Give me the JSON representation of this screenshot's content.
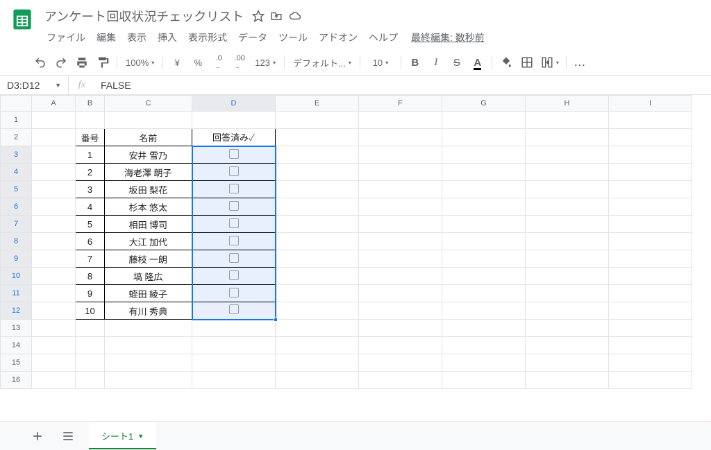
{
  "doc": {
    "title": "アンケート回収状況チェックリスト"
  },
  "menus": [
    "ファイル",
    "編集",
    "表示",
    "挿入",
    "表示形式",
    "データ",
    "ツール",
    "アドオン",
    "ヘルプ"
  ],
  "lastEdit": "最終編集: 数秒前",
  "toolbar": {
    "zoom": "100%",
    "currency": "¥",
    "percent": "%",
    "decDec": ".0",
    "incDec": ".00",
    "numfmt": "123",
    "font": "デフォルト...",
    "fontSize": "10",
    "more": "..."
  },
  "formulaBar": {
    "nameBox": "D3:D12",
    "fx": "fx",
    "value": "FALSE"
  },
  "columns": [
    "A",
    "B",
    "C",
    "D",
    "E",
    "F",
    "G",
    "H",
    "I"
  ],
  "rowCount": 16,
  "tableHeader": {
    "num": "番号",
    "name": "名前",
    "answered": "回答済み",
    "check": "✓"
  },
  "rows": [
    {
      "num": "1",
      "name": "安井 雪乃"
    },
    {
      "num": "2",
      "name": "海老澤 朗子"
    },
    {
      "num": "3",
      "name": "坂田 梨花"
    },
    {
      "num": "4",
      "name": "杉本 悠太"
    },
    {
      "num": "5",
      "name": "相田 博司"
    },
    {
      "num": "6",
      "name": "大江 加代"
    },
    {
      "num": "7",
      "name": "藤枝 一朗"
    },
    {
      "num": "8",
      "name": "塙 隆広"
    },
    {
      "num": "9",
      "name": "蛭田 綾子"
    },
    {
      "num": "10",
      "name": "有川 秀典"
    }
  ],
  "sheetTab": "シート1",
  "selection": {
    "ref": "D3:D12"
  }
}
